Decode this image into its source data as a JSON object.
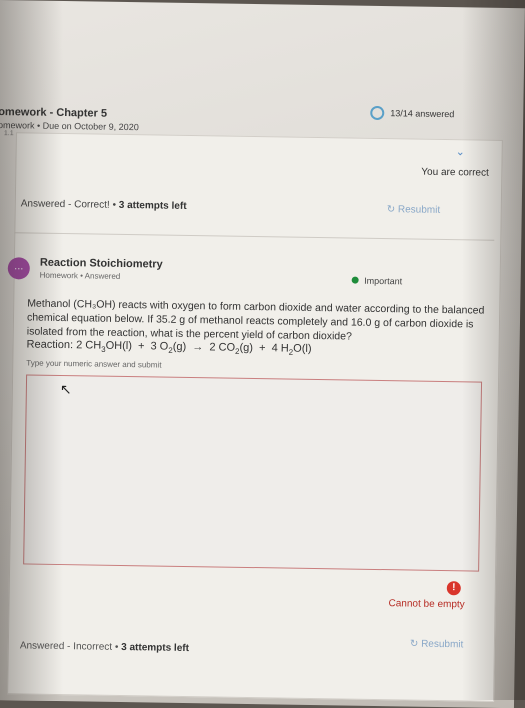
{
  "header": {
    "title": "omework - Chapter 5",
    "subtitle": "omework • Due on October 9, 2020",
    "stamp": "1.1",
    "progress_text": "13/14 answered"
  },
  "question1": {
    "correct_banner": "You are correct",
    "status_prefix": "Answered - Correct!",
    "status_attempts": "3 attempts left",
    "resubmit": "Resubmit"
  },
  "question2": {
    "icon": "...",
    "title": "Reaction Stoichiometry",
    "meta": "Homework • Answered",
    "important": "Important",
    "text": "Methanol (CH₃OH) reacts with oxygen to form carbon dioxide and water according to the balanced chemical equation below. If 35.2 g of methanol reacts completely and 16.0 g of carbon dioxide is isolated from the reaction, what is the percent yield of carbon dioxide?",
    "reaction_label": "Reaction:",
    "hint": "Type your numeric answer and submit",
    "error_badge": "!",
    "error_text": "Cannot be empty",
    "resubmit": "Resubmit",
    "status_prefix": "Answered - Incorrect",
    "status_attempts": "3 attempts left"
  }
}
